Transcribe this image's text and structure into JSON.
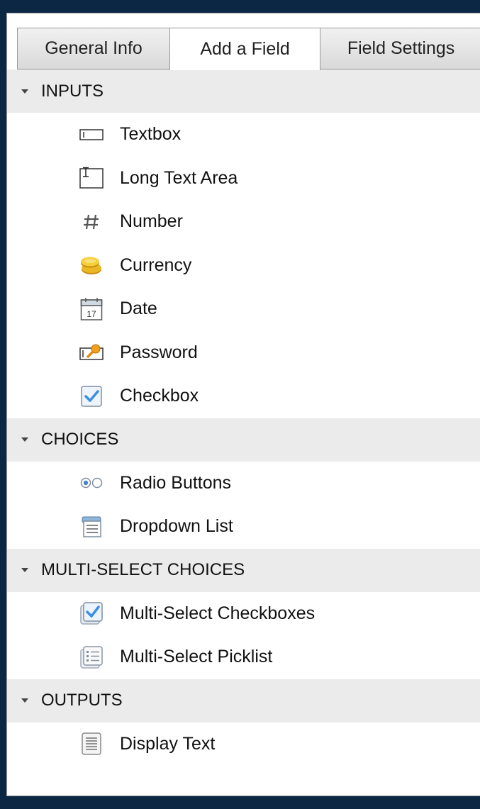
{
  "tabs": [
    {
      "label": "General Info",
      "active": false
    },
    {
      "label": "Add a Field",
      "active": true
    },
    {
      "label": "Field Settings",
      "active": false
    }
  ],
  "sections": [
    {
      "title": "INPUTS",
      "items": [
        {
          "label": "Textbox",
          "icon": "textbox-icon"
        },
        {
          "label": "Long Text Area",
          "icon": "long-text-area-icon"
        },
        {
          "label": "Number",
          "icon": "number-icon"
        },
        {
          "label": "Currency",
          "icon": "currency-icon"
        },
        {
          "label": "Date",
          "icon": "calendar-icon",
          "icon_text": "17"
        },
        {
          "label": "Password",
          "icon": "password-icon"
        },
        {
          "label": "Checkbox",
          "icon": "checkbox-icon"
        }
      ]
    },
    {
      "title": "CHOICES",
      "items": [
        {
          "label": "Radio Buttons",
          "icon": "radio-buttons-icon"
        },
        {
          "label": "Dropdown List",
          "icon": "dropdown-list-icon"
        }
      ]
    },
    {
      "title": "MULTI-SELECT CHOICES",
      "items": [
        {
          "label": "Multi-Select Checkboxes",
          "icon": "multi-select-checkboxes-icon"
        },
        {
          "label": "Multi-Select Picklist",
          "icon": "multi-select-picklist-icon"
        }
      ]
    },
    {
      "title": "OUTPUTS",
      "items": [
        {
          "label": "Display Text",
          "icon": "display-text-icon"
        }
      ]
    }
  ],
  "colors": {
    "background": "#0b2744",
    "section_header": "#ebebeb",
    "checkbox_blue": "#3a8ee6",
    "currency_gold": "#e3b11e"
  }
}
